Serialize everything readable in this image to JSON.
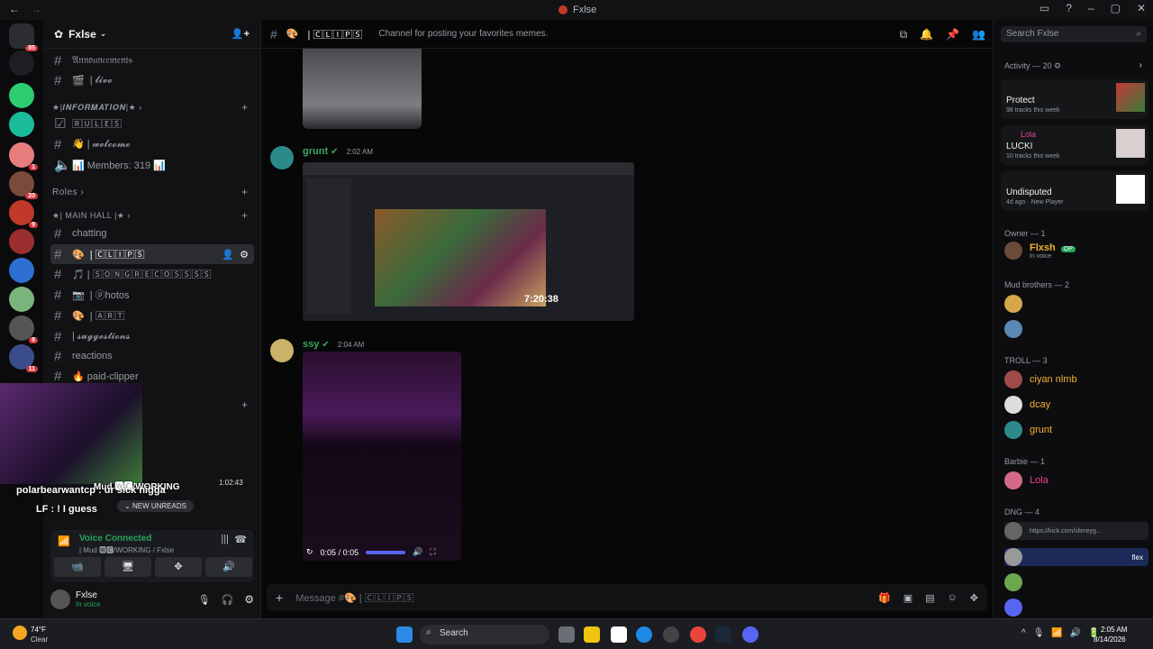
{
  "window": {
    "title": "Fxlse",
    "back": "←",
    "forward": "→"
  },
  "server": {
    "name": "Fxlse"
  },
  "channels": [
    {
      "name": "𝔄𝔫𝔫𝔬𝔲𝔫𝔠𝔢𝔪𝔢𝔫𝔱𝔰",
      "icon": "hash"
    },
    {
      "name": "| 𝓵𝓲𝓿𝓮",
      "icon": "hash"
    },
    {
      "name": "🅁🅄🄻🄴🅂",
      "icon": "rules"
    },
    {
      "name": "👋 | 𝔀𝓮𝓵𝓬𝓸𝓶𝓮",
      "icon": "hash"
    },
    {
      "name": "📊 Members: 319 📊",
      "icon": "speaker"
    },
    {
      "name": "chatting",
      "icon": "hash"
    },
    {
      "name": "| 🄲🄻🄸🄿🅂",
      "icon": "hash"
    },
    {
      "name": "🎵 | 🅂🄾🄽🄶🅁🄴🄲🄾🅂🅂🅂🅂",
      "icon": "hash"
    },
    {
      "name": "| ⓟhotos",
      "icon": "hash"
    },
    {
      "name": "| 🄰🅁🅃",
      "icon": "hash"
    },
    {
      "name": "| 𝓼𝓾𝓰𝓰𝓮𝓼𝓽𝓲𝓸𝓷𝓼",
      "icon": "hash"
    },
    {
      "name": "reactions",
      "icon": "hash"
    },
    {
      "name": "🔥 paid-clipper",
      "icon": "hash"
    }
  ],
  "categories": {
    "information": "★|𝑰𝑵𝑭𝑶𝑹𝑴𝑨𝑻𝑰𝑶𝑵|★",
    "roles": "Roles",
    "main_hall": "★| MAIN HALL |★"
  },
  "stream": {
    "user": "Mud 🆆🅲/WORKING",
    "time": "1:02:43",
    "chat1": "polarbearwantcp : ur sick nigga",
    "chat2": "LF : ! I guess",
    "new_unreads": "NEW UNREADS"
  },
  "voice": {
    "status": "Voice Connected",
    "channel": "| Mud 🆆🅲/WORKING / Fxlse"
  },
  "user": {
    "name": "Fxlse",
    "status": "In voice"
  },
  "header": {
    "channel": "| 🄲🄻🄸🄿🅂",
    "topic": "Channel for posting your favorites memes."
  },
  "messages": [
    {
      "author": "grunt",
      "time": "2:02 AM",
      "author_color": "#3ba55c"
    },
    {
      "author": "ssy",
      "time": "2:04 AM",
      "author_color": "#3ba55c"
    }
  ],
  "video_embed": {
    "timestamp": "7:20:38"
  },
  "player": {
    "time": "0:05 / 0:05",
    "progress": 1.0
  },
  "composer": {
    "placeholder": "Message #🎨 | 🄲🄻🄸🄿🅂"
  },
  "search": {
    "placeholder": "Search Fxlse"
  },
  "activity": {
    "title": "Activity — 20",
    "items": [
      {
        "name": "Protect",
        "sub": "98 tracks this week",
        "user": ""
      },
      {
        "name": "LUCKI",
        "sub": "10 tracks this week",
        "user": "Lola"
      },
      {
        "name": "Undisputed",
        "sub": "4d ago",
        "extra": "New Player",
        "user": ""
      }
    ]
  },
  "member_groups": [
    {
      "title": "Owner — 1"
    },
    {
      "title": "Mud brothers — 2"
    },
    {
      "title": "TROLL — 3"
    },
    {
      "title": "Barbie — 1"
    },
    {
      "title": "DNG — 4"
    }
  ],
  "members": {
    "owner": {
      "name": "Flxsh",
      "badge": "OP",
      "status": "In voice"
    },
    "troll": [
      "ciyan nlmb",
      "dcay",
      "grunt"
    ],
    "barbie": [
      "Lola"
    ],
    "dng_link": "https://kick.com/slimeyg...",
    "dng_flex": "flex"
  },
  "taskbar": {
    "temp": "74°F",
    "weather": "Clear",
    "search": "Search",
    "time": "2:05 AM",
    "date": "8/14/2026"
  }
}
